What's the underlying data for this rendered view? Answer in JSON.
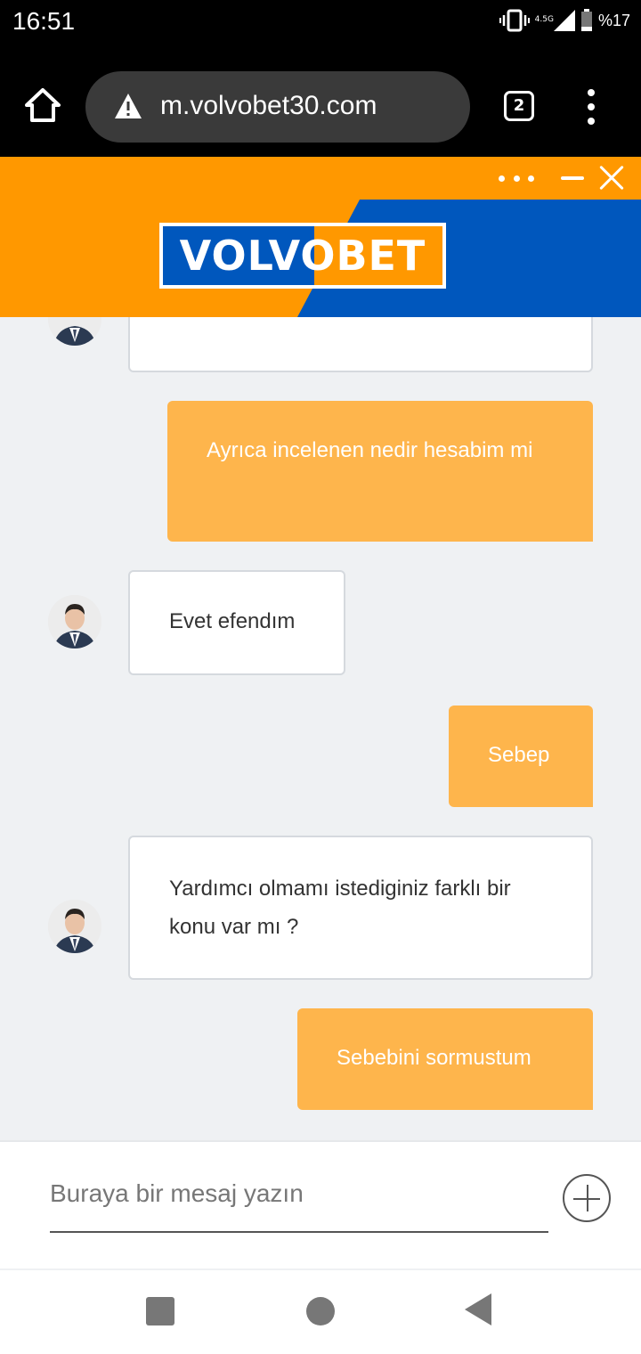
{
  "status_bar": {
    "time": "16:51",
    "network": "4.5G",
    "battery": "%17"
  },
  "browser": {
    "url": "m.volvobet30.com",
    "tab_count": "2"
  },
  "banner": {
    "logo_text": "VOLVOBET",
    "colors": {
      "orange": "#ff9800",
      "blue": "#0057bd"
    }
  },
  "messages": [
    {
      "from": "bot",
      "text": ""
    },
    {
      "from": "user",
      "text": "Ayrıca incelenen nedir hesabim mi"
    },
    {
      "from": "bot",
      "text": "Evet efendım"
    },
    {
      "from": "user",
      "text": "Sebep"
    },
    {
      "from": "bot",
      "text": "Yardımcı olmamı istediginiz farklı bir konu var mı ?"
    },
    {
      "from": "user",
      "text": "Sebebini sormustum"
    }
  ],
  "composer": {
    "placeholder": "Buraya bir mesaj yazın"
  },
  "icons": {
    "home": "home-icon",
    "warning": "warning-icon",
    "menu": "more-vert-icon",
    "minimize": "minimize-icon",
    "close": "close-icon",
    "add": "plus-icon"
  }
}
